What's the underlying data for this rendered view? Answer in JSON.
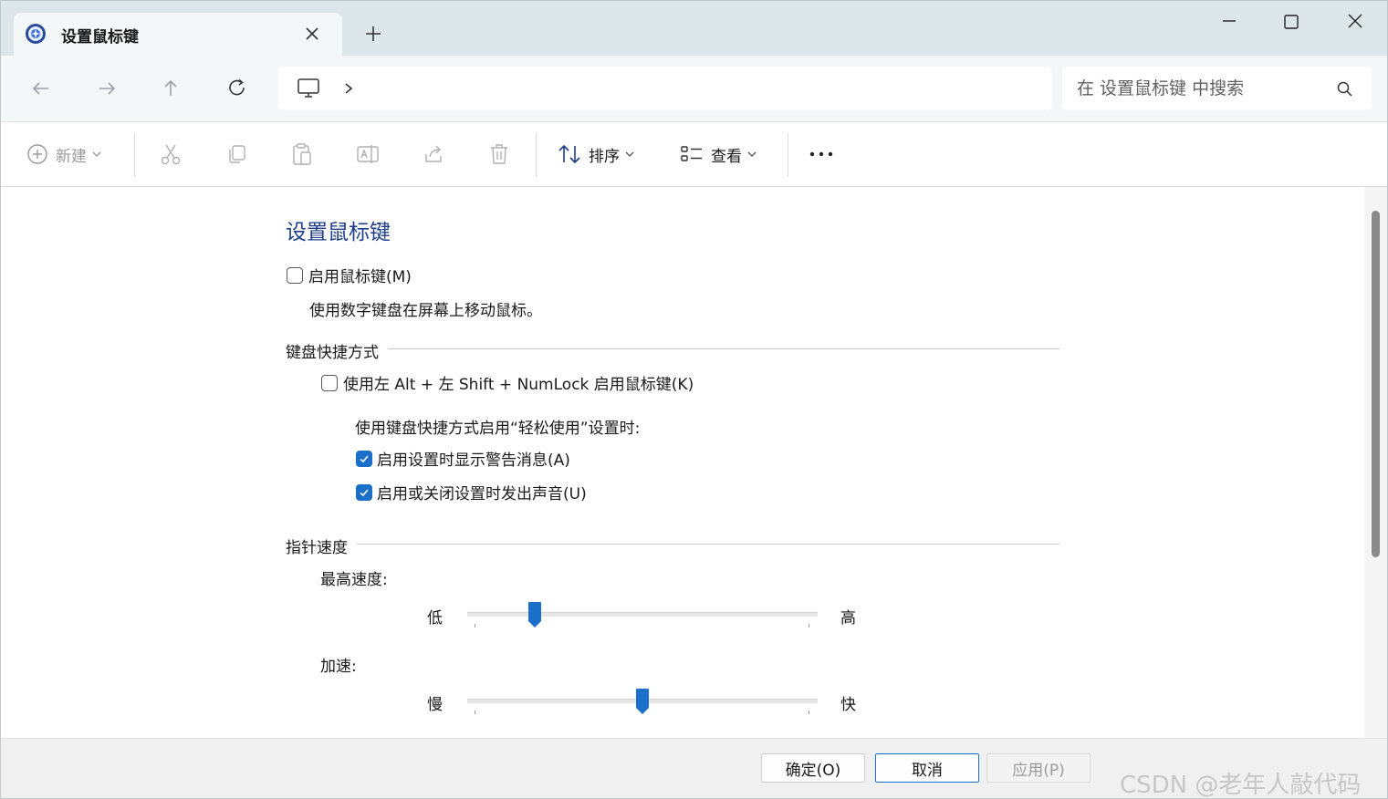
{
  "window": {
    "tab_title": "设置鼠标键"
  },
  "nav": {
    "search_placeholder": "在 设置鼠标键 中搜索"
  },
  "toolbar": {
    "new_label": "新建",
    "sort_label": "排序",
    "view_label": "查看"
  },
  "content": {
    "title": "设置鼠标键",
    "enable_mouse_keys": {
      "label": "启用鼠标键(M)",
      "checked": false
    },
    "enable_description": "使用数字键盘在屏幕上移动鼠标。",
    "keyboard_shortcut": {
      "heading": "键盘快捷方式",
      "shortcut_option": {
        "label": "使用左 Alt + 左 Shift + NumLock 启用鼠标键(K)",
        "checked": false
      },
      "when_label": "使用键盘快捷方式启用“轻松使用”设置时:",
      "show_warning": {
        "label": "启用设置时显示警告消息(A)",
        "checked": true
      },
      "play_sound": {
        "label": "启用或关闭设置时发出声音(U)",
        "checked": true
      }
    },
    "pointer_speed": {
      "heading": "指针速度",
      "top_speed": {
        "label": "最高速度:",
        "min_label": "低",
        "max_label": "高",
        "value": 0.18
      },
      "acceleration": {
        "label": "加速:",
        "min_label": "慢",
        "max_label": "快",
        "value": 0.5
      }
    }
  },
  "footer": {
    "ok_label": "确定(O)",
    "cancel_label": "取消",
    "apply_label": "应用(P)",
    "watermark": "CSDN @老年人敲代码"
  },
  "colors": {
    "accent": "#1a6fc9",
    "title_blue": "#1e3e8c"
  }
}
